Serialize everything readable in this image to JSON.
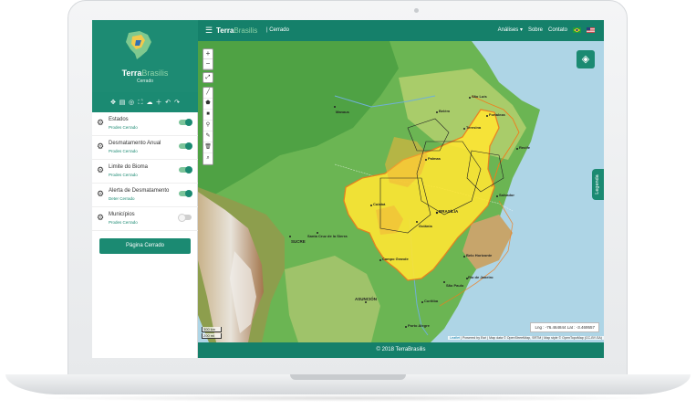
{
  "app": {
    "brand_part1": "Terra",
    "brand_part2": "Brasilis",
    "crumb": "| Cerrado",
    "logo_part1": "Terra",
    "logo_part2": "Brasilis",
    "logo_sub": "Cerrado"
  },
  "nav": {
    "analyses": "Análises ▾",
    "about": "Sobre",
    "contact": "Contato"
  },
  "layers": [
    {
      "name": "Estados",
      "source": "Prodes Cerrado",
      "enabled": true
    },
    {
      "name": "Desmatamento Anual",
      "source": "Prodes Cerrado",
      "enabled": true
    },
    {
      "name": "Limite do Bioma",
      "source": "Prodes Cerrado",
      "enabled": true
    },
    {
      "name": "Alerta de Desmatamento",
      "source": "Deter Cerrado",
      "enabled": true
    },
    {
      "name": "Municípios",
      "source": "Prodes Cerrado",
      "enabled": false
    }
  ],
  "page_button": "Página Cerrado",
  "map": {
    "legend_tab": "Legenda",
    "coords": "Lng : -76.464844 Lat : -3.469557",
    "scale_km": "300 km",
    "scale_mi": "200 mi",
    "attribution_leaflet": "Leaflet",
    "attribution_rest": " | Powered by Esri | Map data © OpenStreetMap, SRTM | Map style © OpenTopoMap (CC-BY-SA)",
    "places": {
      "manaus": "Manaus",
      "fortaleza": "Fortaleza",
      "brasilia": "BRASÍLIA",
      "sucre": "SUCRE",
      "santa_cruz": "Santa Cruz de la Sierra",
      "asuncion": "ASUNCIÓN",
      "rio": "Rio de Janeiro",
      "sao_paulo": "São Paulo",
      "belo_horizonte": "Belo Horizonte",
      "salvador": "Salvador",
      "recife": "Recife",
      "goiania": "Goiânia",
      "cuiaba": "Cuiabá",
      "campo_grande": "Campo Grande",
      "palmas": "Palmas",
      "teresina": "Teresina",
      "curitiba": "Curitiba",
      "porto_alegre": "Porto Alegre",
      "belem": "Belém",
      "sao_luis": "São Luís"
    }
  },
  "footer": "© 2018 TerraBrasilis",
  "icons": {
    "menu": "hamburger-icon",
    "layers": "layers-icon",
    "gear": "gear-icon",
    "flag_br": "brazil-flag-icon",
    "flag_us": "usa-flag-icon"
  },
  "colors": {
    "primary": "#1b8a72",
    "topbar": "#15806a",
    "biome_fill": "#ffe633",
    "biome_border": "#f07c1b"
  }
}
